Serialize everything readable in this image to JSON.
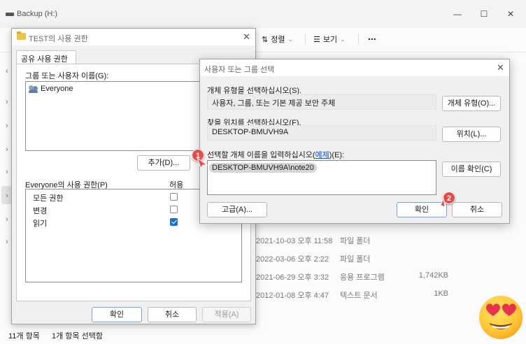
{
  "explorer": {
    "title": "Backup (H:)",
    "toolbar": {
      "sort_label": "정렬",
      "view_label": "보기",
      "more_label": "..."
    },
    "files": [
      {
        "date": "2021-10-03 오후 11:58",
        "type": "파일 폴더",
        "size": ""
      },
      {
        "date": "2022-03-06 오후 2:22",
        "type": "파일 폴더",
        "size": ""
      },
      {
        "date": "2021-06-29 오후 3:32",
        "type": "응용 프로그램",
        "size": "1,742KB"
      },
      {
        "date": "2012-01-08 오후 4:47",
        "type": "텍스트 문서",
        "size": "1KB"
      }
    ],
    "status": {
      "item_count": "11개 항목",
      "selected": "1개 항목 선택함"
    }
  },
  "permissions_dialog": {
    "title": "TEST의 사용 권한",
    "tab_label": "공유 사용 권한",
    "group_label": "그룹 또는 사용자 이름(G):",
    "users": [
      "Everyone"
    ],
    "add_button": "추가(D)...",
    "perm_header": "Everyone의 사용 권한(P)",
    "allow_header": "허용",
    "permissions": [
      {
        "name": "모든 권한",
        "allow": false
      },
      {
        "name": "변경",
        "allow": false
      },
      {
        "name": "읽기",
        "allow": true
      }
    ],
    "ok_button": "확인",
    "cancel_button": "취소",
    "apply_button": "적용(A)"
  },
  "select_dialog": {
    "title": "사용자 또는 그룹 선택",
    "object_type_label": "개체 유형을 선택하십시오(S).",
    "object_type_value": "사용자, 그룹, 또는 기본 제공 보안 주체",
    "object_type_button": "개체 유형(O)...",
    "location_label": "찾을 위치를 선택하십시오(F).",
    "location_value": "DESKTOP-BMUVH9A",
    "location_button": "위치(L)...",
    "names_label_prefix": "선택할 개체 이름을 입력하십시오(",
    "names_label_link": "예제",
    "names_label_suffix": ")(E):",
    "names_value": "DESKTOP-BMUVH9A\\note20",
    "check_names_button": "이름 확인(C)",
    "advanced_button": "고급(A)...",
    "ok_button": "확인",
    "cancel_button": "취소"
  },
  "markers": [
    "1",
    "2"
  ],
  "colors": {
    "accent": "#1a6fd1",
    "marker": "#e84a4a",
    "link": "#0b55c4"
  }
}
